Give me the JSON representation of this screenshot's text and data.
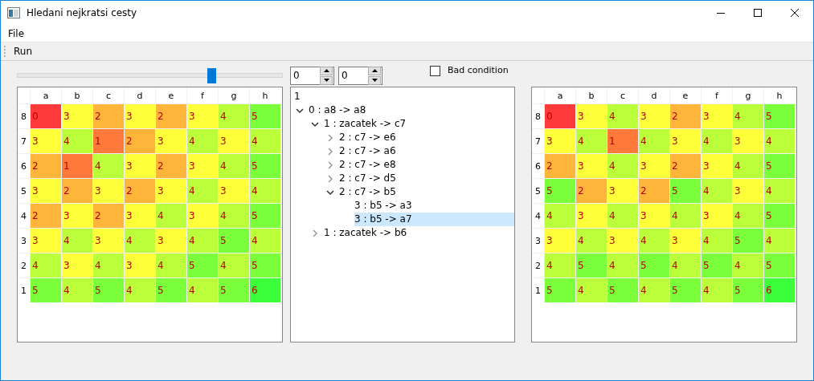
{
  "window": {
    "title": "Hledani nejkratsi cesty"
  },
  "menu": [
    "File"
  ],
  "toolbar": [
    "Run"
  ],
  "slider": {
    "level": 0.73
  },
  "spinboxes": [
    {
      "value": "0"
    },
    {
      "value": "0"
    }
  ],
  "bad_condition": {
    "label": "Bad condition",
    "checked": false
  },
  "boards": [
    {
      "columns": [
        "a",
        "b",
        "c",
        "d",
        "e",
        "f",
        "g",
        "h"
      ],
      "rows": [
        {
          "label": "8",
          "cells": [
            {
              "value": "0",
              "color": "#ff3a3a"
            },
            {
              "value": "3",
              "color": "#ffff3a"
            },
            {
              "value": "2",
              "color": "#ffb43a"
            },
            {
              "value": "3",
              "color": "#ffff3a"
            },
            {
              "value": "2",
              "color": "#ffb43a"
            },
            {
              "value": "3",
              "color": "#ffff3a"
            },
            {
              "value": "4",
              "color": "#bbff3a"
            },
            {
              "value": "5",
              "color": "#7aff3a"
            }
          ]
        },
        {
          "label": "7",
          "cells": [
            {
              "value": "3",
              "color": "#ffff3a"
            },
            {
              "value": "4",
              "color": "#bbff3a"
            },
            {
              "value": "1",
              "color": "#ff7a3a"
            },
            {
              "value": "2",
              "color": "#ffb43a"
            },
            {
              "value": "3",
              "color": "#ffff3a"
            },
            {
              "value": "4",
              "color": "#bbff3a"
            },
            {
              "value": "3",
              "color": "#ffff3a"
            },
            {
              "value": "4",
              "color": "#bbff3a"
            }
          ]
        },
        {
          "label": "6",
          "cells": [
            {
              "value": "2",
              "color": "#ffb43a"
            },
            {
              "value": "1",
              "color": "#ff7a3a"
            },
            {
              "value": "4",
              "color": "#bbff3a"
            },
            {
              "value": "3",
              "color": "#ffff3a"
            },
            {
              "value": "2",
              "color": "#ffb43a"
            },
            {
              "value": "3",
              "color": "#ffff3a"
            },
            {
              "value": "4",
              "color": "#bbff3a"
            },
            {
              "value": "5",
              "color": "#7aff3a"
            }
          ]
        },
        {
          "label": "5",
          "cells": [
            {
              "value": "3",
              "color": "#ffff3a"
            },
            {
              "value": "2",
              "color": "#ffb43a"
            },
            {
              "value": "3",
              "color": "#ffff3a"
            },
            {
              "value": "2",
              "color": "#ffb43a"
            },
            {
              "value": "3",
              "color": "#ffff3a"
            },
            {
              "value": "4",
              "color": "#bbff3a"
            },
            {
              "value": "3",
              "color": "#ffff3a"
            },
            {
              "value": "4",
              "color": "#bbff3a"
            }
          ]
        },
        {
          "label": "4",
          "cells": [
            {
              "value": "2",
              "color": "#ffb43a"
            },
            {
              "value": "3",
              "color": "#ffff3a"
            },
            {
              "value": "2",
              "color": "#ffb43a"
            },
            {
              "value": "3",
              "color": "#ffff3a"
            },
            {
              "value": "4",
              "color": "#bbff3a"
            },
            {
              "value": "3",
              "color": "#ffff3a"
            },
            {
              "value": "4",
              "color": "#bbff3a"
            },
            {
              "value": "5",
              "color": "#7aff3a"
            }
          ]
        },
        {
          "label": "3",
          "cells": [
            {
              "value": "3",
              "color": "#ffff3a"
            },
            {
              "value": "4",
              "color": "#bbff3a"
            },
            {
              "value": "3",
              "color": "#ffff3a"
            },
            {
              "value": "4",
              "color": "#bbff3a"
            },
            {
              "value": "3",
              "color": "#ffff3a"
            },
            {
              "value": "4",
              "color": "#bbff3a"
            },
            {
              "value": "5",
              "color": "#7aff3a"
            },
            {
              "value": "4",
              "color": "#bbff3a"
            }
          ]
        },
        {
          "label": "2",
          "cells": [
            {
              "value": "4",
              "color": "#bbff3a"
            },
            {
              "value": "3",
              "color": "#ffff3a"
            },
            {
              "value": "4",
              "color": "#bbff3a"
            },
            {
              "value": "3",
              "color": "#ffff3a"
            },
            {
              "value": "4",
              "color": "#bbff3a"
            },
            {
              "value": "5",
              "color": "#7aff3a"
            },
            {
              "value": "4",
              "color": "#bbff3a"
            },
            {
              "value": "5",
              "color": "#7aff3a"
            }
          ]
        },
        {
          "label": "1",
          "cells": [
            {
              "value": "5",
              "color": "#7aff3a"
            },
            {
              "value": "4",
              "color": "#bbff3a"
            },
            {
              "value": "5",
              "color": "#7aff3a"
            },
            {
              "value": "4",
              "color": "#bbff3a"
            },
            {
              "value": "5",
              "color": "#7aff3a"
            },
            {
              "value": "4",
              "color": "#bbff3a"
            },
            {
              "value": "5",
              "color": "#7aff3a"
            },
            {
              "value": "6",
              "color": "#3aff3a"
            }
          ]
        }
      ]
    },
    {
      "columns": [
        "a",
        "b",
        "c",
        "d",
        "e",
        "f",
        "g",
        "h"
      ],
      "rows": [
        {
          "label": "8",
          "cells": [
            {
              "value": "0",
              "color": "#ff3a3a"
            },
            {
              "value": "3",
              "color": "#ffff3a"
            },
            {
              "value": "4",
              "color": "#bbff3a"
            },
            {
              "value": "3",
              "color": "#ffff3a"
            },
            {
              "value": "2",
              "color": "#ffb43a"
            },
            {
              "value": "3",
              "color": "#ffff3a"
            },
            {
              "value": "4",
              "color": "#bbff3a"
            },
            {
              "value": "5",
              "color": "#7aff3a"
            }
          ]
        },
        {
          "label": "7",
          "cells": [
            {
              "value": "3",
              "color": "#ffff3a"
            },
            {
              "value": "4",
              "color": "#bbff3a"
            },
            {
              "value": "1",
              "color": "#ff7a3a"
            },
            {
              "value": "4",
              "color": "#bbff3a"
            },
            {
              "value": "3",
              "color": "#ffff3a"
            },
            {
              "value": "4",
              "color": "#bbff3a"
            },
            {
              "value": "3",
              "color": "#ffff3a"
            },
            {
              "value": "4",
              "color": "#bbff3a"
            }
          ]
        },
        {
          "label": "6",
          "cells": [
            {
              "value": "2",
              "color": "#ffb43a"
            },
            {
              "value": "3",
              "color": "#ffff3a"
            },
            {
              "value": "4",
              "color": "#bbff3a"
            },
            {
              "value": "3",
              "color": "#ffff3a"
            },
            {
              "value": "2",
              "color": "#ffb43a"
            },
            {
              "value": "3",
              "color": "#ffff3a"
            },
            {
              "value": "4",
              "color": "#bbff3a"
            },
            {
              "value": "5",
              "color": "#7aff3a"
            }
          ]
        },
        {
          "label": "5",
          "cells": [
            {
              "value": "5",
              "color": "#7aff3a"
            },
            {
              "value": "2",
              "color": "#ffb43a"
            },
            {
              "value": "3",
              "color": "#ffff3a"
            },
            {
              "value": "2",
              "color": "#ffb43a"
            },
            {
              "value": "5",
              "color": "#7aff3a"
            },
            {
              "value": "4",
              "color": "#bbff3a"
            },
            {
              "value": "3",
              "color": "#ffff3a"
            },
            {
              "value": "4",
              "color": "#bbff3a"
            }
          ]
        },
        {
          "label": "4",
          "cells": [
            {
              "value": "4",
              "color": "#bbff3a"
            },
            {
              "value": "3",
              "color": "#ffff3a"
            },
            {
              "value": "4",
              "color": "#bbff3a"
            },
            {
              "value": "3",
              "color": "#ffff3a"
            },
            {
              "value": "4",
              "color": "#bbff3a"
            },
            {
              "value": "3",
              "color": "#ffff3a"
            },
            {
              "value": "4",
              "color": "#bbff3a"
            },
            {
              "value": "5",
              "color": "#7aff3a"
            }
          ]
        },
        {
          "label": "3",
          "cells": [
            {
              "value": "3",
              "color": "#ffff3a"
            },
            {
              "value": "4",
              "color": "#bbff3a"
            },
            {
              "value": "3",
              "color": "#ffff3a"
            },
            {
              "value": "4",
              "color": "#bbff3a"
            },
            {
              "value": "3",
              "color": "#ffff3a"
            },
            {
              "value": "4",
              "color": "#bbff3a"
            },
            {
              "value": "5",
              "color": "#7aff3a"
            },
            {
              "value": "4",
              "color": "#bbff3a"
            }
          ]
        },
        {
          "label": "2",
          "cells": [
            {
              "value": "4",
              "color": "#bbff3a"
            },
            {
              "value": "5",
              "color": "#7aff3a"
            },
            {
              "value": "4",
              "color": "#bbff3a"
            },
            {
              "value": "5",
              "color": "#7aff3a"
            },
            {
              "value": "4",
              "color": "#bbff3a"
            },
            {
              "value": "5",
              "color": "#7aff3a"
            },
            {
              "value": "4",
              "color": "#bbff3a"
            },
            {
              "value": "5",
              "color": "#7aff3a"
            }
          ]
        },
        {
          "label": "1",
          "cells": [
            {
              "value": "5",
              "color": "#7aff3a"
            },
            {
              "value": "4",
              "color": "#bbff3a"
            },
            {
              "value": "5",
              "color": "#7aff3a"
            },
            {
              "value": "4",
              "color": "#bbff3a"
            },
            {
              "value": "5",
              "color": "#7aff3a"
            },
            {
              "value": "4",
              "color": "#bbff3a"
            },
            {
              "value": "5",
              "color": "#7aff3a"
            },
            {
              "value": "6",
              "color": "#3aff3a"
            }
          ]
        }
      ]
    }
  ],
  "tree": {
    "header": "1",
    "items": [
      {
        "label": "0 : a8 -> a8",
        "kind": "branch",
        "expanded": true,
        "selected": false,
        "children": [
          {
            "label": "1 : zacatek -> c7",
            "kind": "branch",
            "expanded": true,
            "selected": false,
            "children": [
              {
                "label": "2 : c7 -> e6",
                "kind": "branch",
                "expanded": false,
                "selected": false
              },
              {
                "label": "2 : c7 -> a6",
                "kind": "branch",
                "expanded": false,
                "selected": false
              },
              {
                "label": "2 : c7 -> e8",
                "kind": "branch",
                "expanded": false,
                "selected": false
              },
              {
                "label": "2 : c7 -> d5",
                "kind": "branch",
                "expanded": false,
                "selected": false
              },
              {
                "label": "2 : c7 -> b5",
                "kind": "branch",
                "expanded": true,
                "selected": false,
                "children": [
                  {
                    "label": "3 : b5 -> a3",
                    "kind": "leaf",
                    "selected": false
                  },
                  {
                    "label": "3 : b5 -> a7",
                    "kind": "leaf",
                    "selected": true
                  }
                ]
              }
            ]
          },
          {
            "label": "1 : zacatek -> b6",
            "kind": "branch",
            "expanded": false,
            "selected": false
          }
        ]
      }
    ]
  }
}
